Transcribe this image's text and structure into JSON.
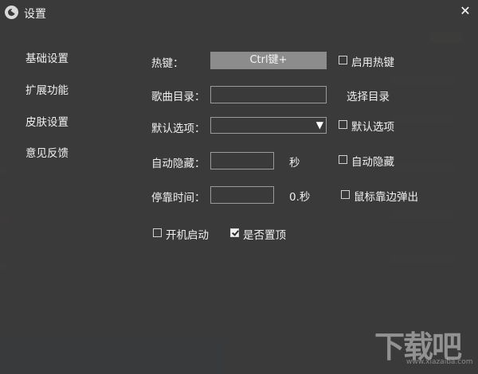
{
  "window": {
    "title": "设置",
    "close_glyph": "✕"
  },
  "sidebar": {
    "items": [
      {
        "label": "基础设置"
      },
      {
        "label": "扩展功能"
      },
      {
        "label": "皮肤设置"
      },
      {
        "label": "意见反馈"
      }
    ]
  },
  "form": {
    "hotkey": {
      "label": "热键：",
      "value": "Ctrl键+",
      "checkbox_label": "启用热键",
      "checked": false
    },
    "music_dir": {
      "label": "歌曲目录：",
      "value": "",
      "button_label": "选择目录"
    },
    "default_option": {
      "label": "默认选项：",
      "value": "",
      "checkbox_label": "默认选项",
      "checked": false
    },
    "auto_hide": {
      "label": "自动隐藏：",
      "value": "",
      "unit": "秒",
      "checkbox_label": "自动隐藏",
      "checked": false
    },
    "dock_time": {
      "label": "停靠时间：",
      "value": "",
      "unit": "0.秒",
      "checkbox_label": "鼠标靠边弹出",
      "checked": false
    },
    "startup": {
      "label": "开机启动",
      "checked": false
    },
    "always_on_top": {
      "label": "是否置顶",
      "checked": true
    }
  },
  "watermark": {
    "text": "下载吧",
    "url": "www.xiazaiba.com"
  }
}
